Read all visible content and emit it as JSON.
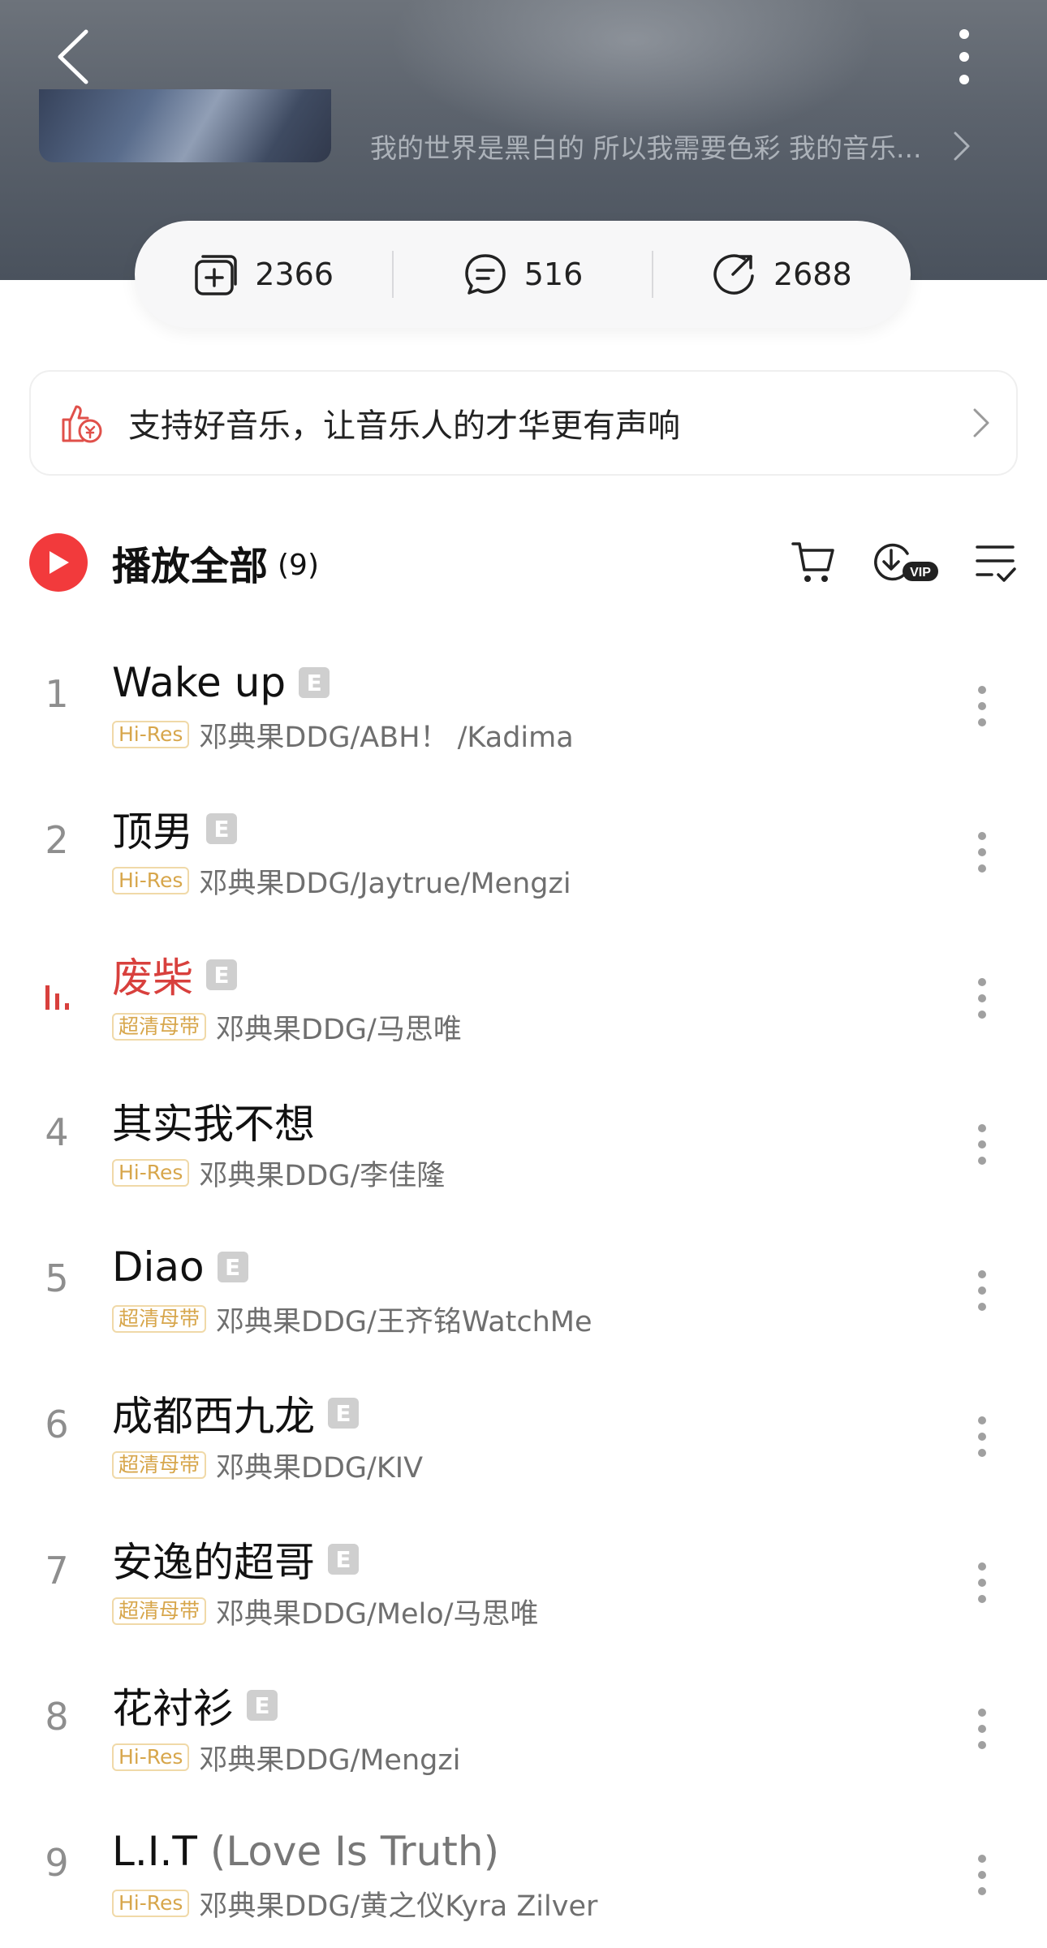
{
  "header": {
    "description": "我的世界是黑白的 所以我需要色彩 我的音乐..."
  },
  "stats": {
    "collect": "2366",
    "comment": "516",
    "share": "2688"
  },
  "support": {
    "text": "支持好音乐，让音乐人的才华更有声响"
  },
  "playall": {
    "label": "播放全部",
    "count": "(9)"
  },
  "songs": [
    {
      "index": "1",
      "title": "Wake up",
      "title_sub": "",
      "explicit": "E",
      "quality": "Hi-Res",
      "artists": "邓典果DDG/ABH！ /Kadima",
      "playing": false
    },
    {
      "index": "2",
      "title": "顶男",
      "title_sub": "",
      "explicit": "E",
      "quality": "Hi-Res",
      "artists": "邓典果DDG/Jaytrue/Mengzi",
      "playing": false
    },
    {
      "index": "",
      "title": "废柴",
      "title_sub": "",
      "explicit": "E",
      "quality": "超清母带",
      "artists": "邓典果DDG/马思唯",
      "playing": true
    },
    {
      "index": "4",
      "title": "其实我不想",
      "title_sub": "",
      "explicit": "",
      "quality": "Hi-Res",
      "artists": "邓典果DDG/李佳隆",
      "playing": false
    },
    {
      "index": "5",
      "title": "Diao",
      "title_sub": "",
      "explicit": "E",
      "quality": "超清母带",
      "artists": "邓典果DDG/王齐铭WatchMe",
      "playing": false
    },
    {
      "index": "6",
      "title": "成都西九龙",
      "title_sub": "",
      "explicit": "E",
      "quality": "超清母带",
      "artists": "邓典果DDG/KIV",
      "playing": false
    },
    {
      "index": "7",
      "title": "安逸的超哥",
      "title_sub": "",
      "explicit": "E",
      "quality": "超清母带",
      "artists": "邓典果DDG/Melo/马思唯",
      "playing": false
    },
    {
      "index": "8",
      "title": "花衬衫",
      "title_sub": "",
      "explicit": "E",
      "quality": "Hi-Res",
      "artists": "邓典果DDG/Mengzi",
      "playing": false
    },
    {
      "index": "9",
      "title": "L.I.T",
      "title_sub": " (Love Is Truth)",
      "explicit": "",
      "quality": "Hi-Res",
      "artists": "邓典果DDG/黄之仪Kyra Zilver",
      "playing": false
    }
  ],
  "icons": {
    "back": "back-arrow-icon",
    "more": "more-vertical-icon",
    "collect": "add-collection-icon",
    "comment": "comment-icon",
    "share": "share-icon",
    "support": "thumbs-up-coin-icon",
    "cart": "cart-icon",
    "download": "download-vip-icon",
    "multiselect": "multi-select-icon",
    "playing": "equalizer-icon"
  },
  "colors": {
    "accent": "#f23a3c",
    "playing_text": "#d8403d",
    "quality_text": "#d7a64b"
  }
}
